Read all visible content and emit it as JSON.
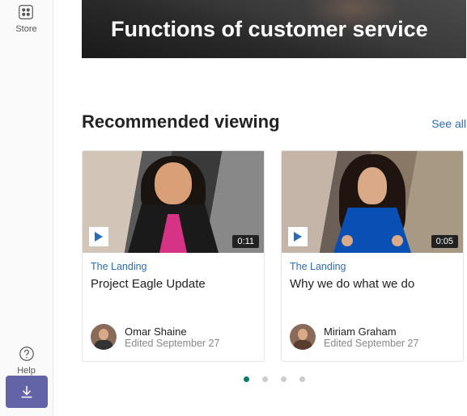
{
  "sidebar": {
    "store_label": "Store",
    "help_label": "Help"
  },
  "hero": {
    "title": "Functions of customer service"
  },
  "recommended": {
    "heading": "Recommended viewing",
    "see_all": "See all",
    "cards": [
      {
        "category": "The Landing",
        "title": "Project Eagle Update",
        "duration": "0:11",
        "author": "Omar Shaine",
        "edited": "Edited September 27"
      },
      {
        "category": "The Landing",
        "title": "Why we do what we do",
        "duration": "0:05",
        "author": "Miriam Graham",
        "edited": "Edited September 27"
      }
    ],
    "page_count": 4,
    "active_page": 0
  }
}
